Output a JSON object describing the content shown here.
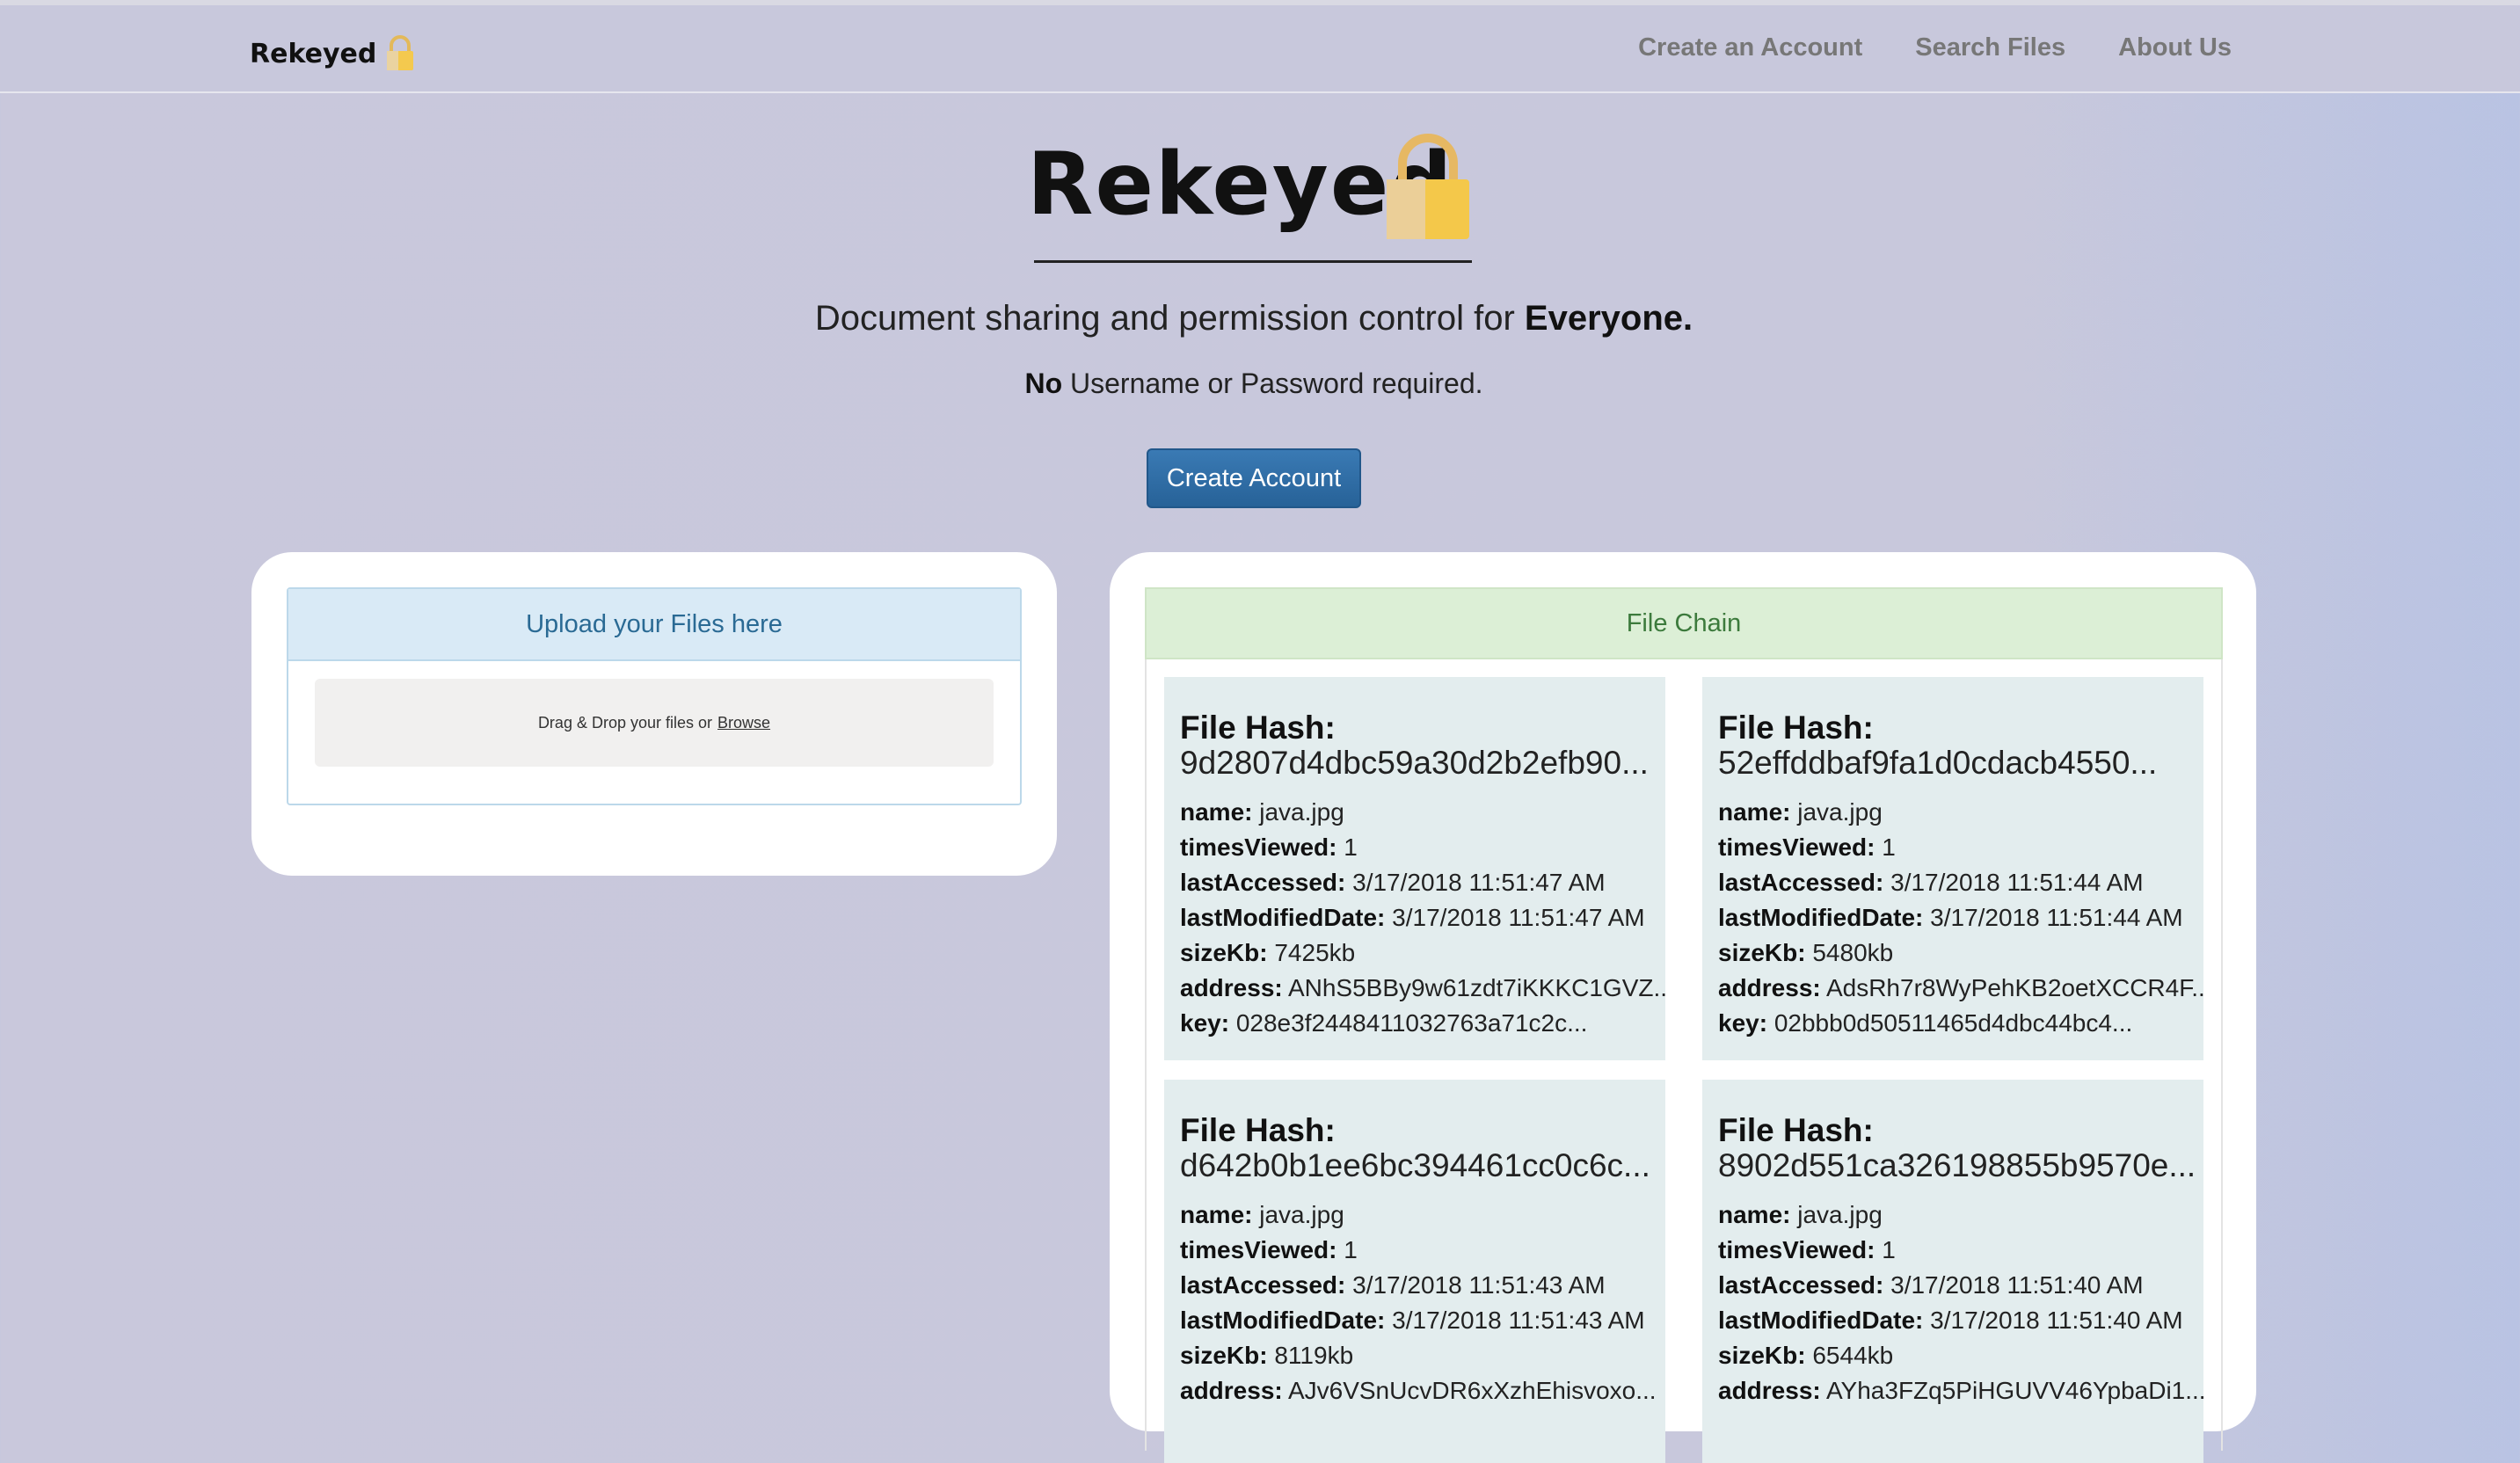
{
  "nav": {
    "brand": "Rekeyed",
    "links": [
      "Create an Account",
      "Search Files",
      "About Us"
    ]
  },
  "hero": {
    "title": "Rekeyed",
    "tagline_prefix": "Document sharing and permission control for",
    "tagline_bold": "Everyone.",
    "sub_bold": "No",
    "sub_rest": "Username or Password required.",
    "cta_label": "Create Account"
  },
  "upload": {
    "heading": "Upload your Files here",
    "drop_text": "Drag & Drop your files or",
    "browse_label": "Browse"
  },
  "chain": {
    "heading": "File Chain",
    "hash_label": "File Hash:",
    "field_labels": {
      "name": "name:",
      "timesViewed": "timesViewed:",
      "lastAccessed": "lastAccessed:",
      "lastModifiedDate": "lastModifiedDate:",
      "sizeKb": "sizeKb:",
      "address": "address:",
      "key": "key:"
    },
    "files": [
      {
        "hash": "9d2807d4dbc59a30d2b2efb90...",
        "name": "java.jpg",
        "timesViewed": "1",
        "lastAccessed": "3/17/2018 11:51:47 AM",
        "lastModifiedDate": "3/17/2018 11:51:47 AM",
        "sizeKb": "7425kb",
        "address": "ANhS5BBy9w61zdt7iKKKC1GVZ...",
        "key": "028e3f2448411032763a71c2c..."
      },
      {
        "hash": "52effddbaf9fa1d0cdacb4550...",
        "name": "java.jpg",
        "timesViewed": "1",
        "lastAccessed": "3/17/2018 11:51:44 AM",
        "lastModifiedDate": "3/17/2018 11:51:44 AM",
        "sizeKb": "5480kb",
        "address": "AdsRh7r8WyPehKB2oetXCCR4F...",
        "key": "02bbb0d50511465d4dbc44bc4..."
      },
      {
        "hash": "d642b0b1ee6bc394461cc0c6c...",
        "name": "java.jpg",
        "timesViewed": "1",
        "lastAccessed": "3/17/2018 11:51:43 AM",
        "lastModifiedDate": "3/17/2018 11:51:43 AM",
        "sizeKb": "8119kb",
        "address": "AJv6VSnUcvDR6xXzhEhisvoxo...",
        "key": ""
      },
      {
        "hash": "8902d551ca326198855b9570e...",
        "name": "java.jpg",
        "timesViewed": "1",
        "lastAccessed": "3/17/2018 11:51:40 AM",
        "lastModifiedDate": "3/17/2018 11:51:40 AM",
        "sizeKb": "6544kb",
        "address": "AYha3FZq5PiHGUVV46YpbaDi1...",
        "key": ""
      }
    ]
  },
  "colors": {
    "background": "#c8c8dc",
    "cta": "#2e6ba3",
    "upload_header": "#d9eaf6",
    "chain_header": "#dcefd6",
    "file_card": "#e3edee",
    "lock_gold": "#f2c14e"
  },
  "icons": {
    "brand_lock": "padlock-icon",
    "hero_lock": "padlock-icon"
  }
}
